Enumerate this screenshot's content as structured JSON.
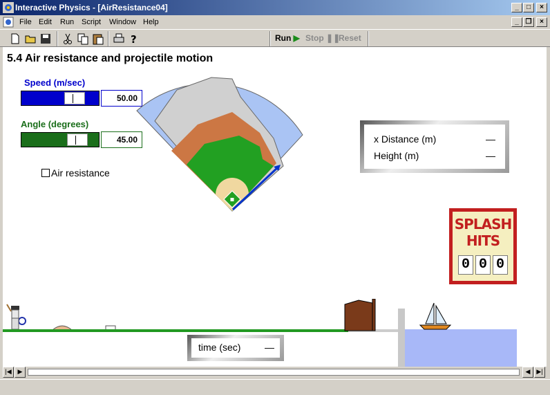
{
  "window": {
    "title": "Interactive Physics - [AirResistance04]"
  },
  "menu": {
    "items": [
      "File",
      "Edit",
      "Run",
      "Script",
      "Window",
      "Help"
    ]
  },
  "toolbar": {
    "icons": [
      "new-file-icon",
      "open-folder-icon",
      "save-icon",
      "cut-icon",
      "copy-icon",
      "paste-icon",
      "print-icon",
      "help-icon"
    ],
    "run_label": "Run",
    "stop_label": "Stop",
    "reset_label": "Reset"
  },
  "main": {
    "title": "5.4 Air resistance and projectile motion",
    "speed": {
      "label": "Speed (m/sec)",
      "value": "50.00",
      "slider_fraction": 0.75,
      "color": "#0000cc"
    },
    "angle": {
      "label": "Angle (degrees)",
      "value": "45.00",
      "slider_fraction": 0.67,
      "color": "#1a6e1a"
    },
    "air_resistance": {
      "label": "Air resistance",
      "checked": false
    },
    "readout": {
      "rows": [
        {
          "label": "x Distance (m)",
          "value": "—"
        },
        {
          "label": "Height (m)",
          "value": "—"
        }
      ]
    },
    "time_readout": {
      "label": "time (sec)",
      "value": "—"
    },
    "splash": {
      "line1": "SPLASH",
      "line2": "HITS",
      "digits": [
        "0",
        "0",
        "0"
      ]
    }
  },
  "colors": {
    "titlebar": "#0a246a",
    "water": "#a8b8f8",
    "grass": "#229922",
    "infield": "#cc7744",
    "stands": "#aac4f4",
    "sign": "#c21f1f"
  }
}
